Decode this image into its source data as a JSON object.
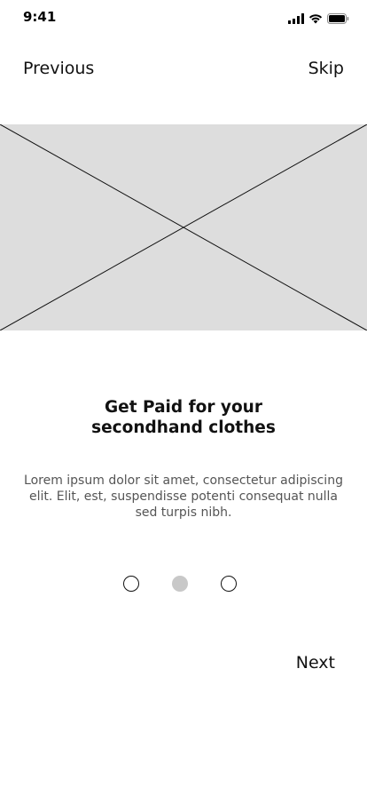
{
  "status_bar": {
    "time": "9:41",
    "icons": [
      "signal-icon",
      "wifi-icon",
      "battery-icon"
    ]
  },
  "nav": {
    "previous_label": "Previous",
    "skip_label": "Skip"
  },
  "onboarding": {
    "title_line1": "Get Paid for your",
    "title_line2": "secondhand clothes",
    "description": "Lorem ipsum dolor sit amet, consectetur adipiscing elit. Elit, est, suspendisse potenti consequat nulla sed turpis nibh.",
    "pages": 3,
    "current_page": 2
  },
  "footer": {
    "next_label": "Next"
  },
  "colors": {
    "placeholder": "#dddddd",
    "active_dot": "#c8c8c8",
    "text_primary": "#111111",
    "text_secondary": "#555555"
  }
}
